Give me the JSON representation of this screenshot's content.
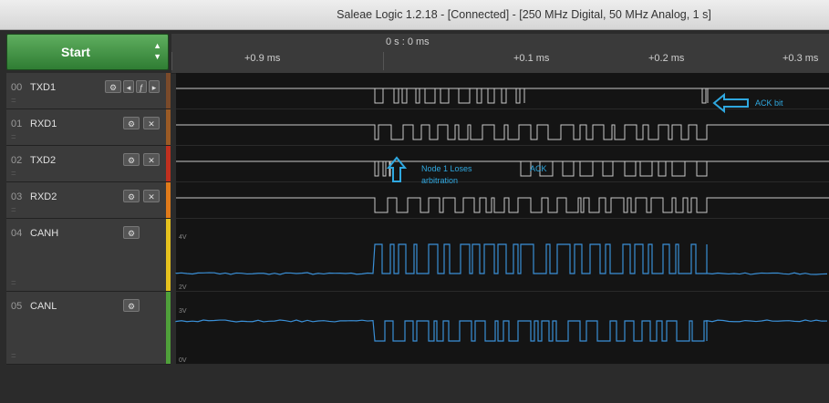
{
  "window": {
    "title": "Saleae Logic 1.2.18 - [Connected] - [250 MHz Digital, 50 MHz Analog, 1 s]"
  },
  "start_button": {
    "label": "Start"
  },
  "timeline": {
    "center": "0 s : 0 ms",
    "ticks": [
      "+0.9 ms",
      "+0.1 ms",
      "+0.2 ms",
      "+0.3 ms"
    ]
  },
  "channels": [
    {
      "num": "00",
      "name": "TXD1",
      "color": "#7a4a2a"
    },
    {
      "num": "01",
      "name": "RXD1",
      "color": "#9a5a25"
    },
    {
      "num": "02",
      "name": "TXD2",
      "color": "#c0301f"
    },
    {
      "num": "03",
      "name": "RXD2",
      "color": "#e07a1a"
    },
    {
      "num": "04",
      "name": "CANH",
      "color": "#e6c21e",
      "analog_labels": [
        "4V",
        "2V"
      ]
    },
    {
      "num": "05",
      "name": "CANL",
      "color": "#4fa03a",
      "analog_labels": [
        "3V",
        "0V"
      ]
    }
  ],
  "annotations": {
    "ack_bit": "ACK bit",
    "node_loses_1": "Node 1 Loses",
    "node_loses_2": "arbitration",
    "ack": "ACK"
  },
  "colors": {
    "signal": "#c9c9c9",
    "analog": "#3a8fd6",
    "annotation": "#2fa8e0"
  }
}
